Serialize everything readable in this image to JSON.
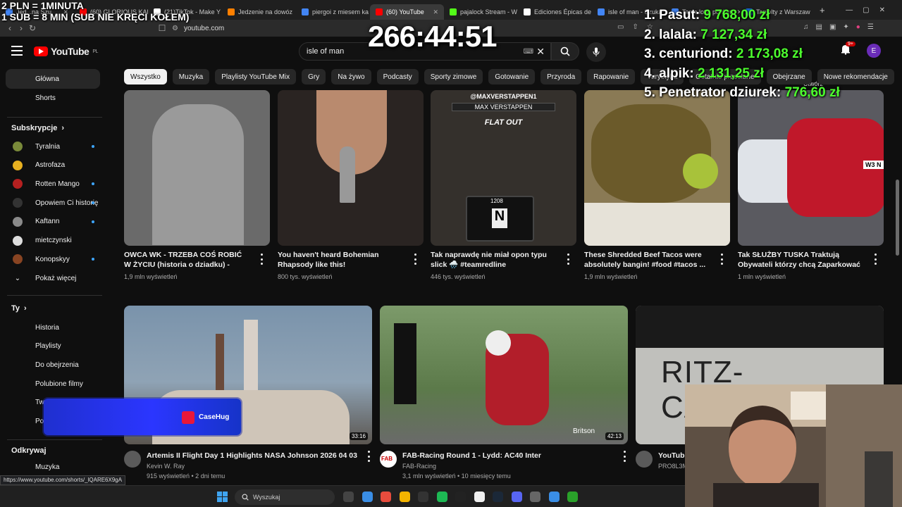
{
  "browser": {
    "tabs": [
      {
        "title": "Jed...na Szu",
        "fav": "#4285f4"
      },
      {
        "title": "(60) GLORIOUS KAR",
        "fav": "#ff0000"
      },
      {
        "title": "(21)TikTok - Make Y",
        "fav": "#ffffff"
      },
      {
        "title": "Jedzenie na dowóz",
        "fav": "#ff8000"
      },
      {
        "title": "piergoi z miesem ka",
        "fav": "#4285f4"
      },
      {
        "title": "(60) YouTube",
        "fav": "#ff0000"
      },
      {
        "title": "pajalock Stream - W",
        "fav": "#53fc18"
      },
      {
        "title": "Ediciones Épicas de",
        "fav": "#ffffff"
      },
      {
        "title": "isle of man - Szuka",
        "fav": "#4285f4"
      },
      {
        "title": "Tanie loty: porówn",
        "fav": "#4285f4"
      },
      {
        "title": "Taniolty z Warszaw",
        "fav": "#1a73e8"
      }
    ],
    "url": "youtube.com"
  },
  "yt": {
    "logo_text": "YouTube",
    "logo_region": "PL",
    "search_value": "isle of man",
    "notif_count": "9+",
    "profile_initial": "E",
    "user_label": "Utwórz"
  },
  "chips": [
    "Wszystko",
    "Muzyka",
    "Playlisty YouTube Mix",
    "Gry",
    "Na żywo",
    "Podcasty",
    "Sporty zimowe",
    "Gotowanie",
    "Przyroda",
    "Rapowanie",
    "Turystyka",
    "Ostatnio przesłane",
    "Obejrzane",
    "Nowe rekomendacje"
  ],
  "sidebar": {
    "main": [
      {
        "label": "Główna",
        "icon": "home-icon"
      },
      {
        "label": "Shorts",
        "icon": "shorts-icon"
      }
    ],
    "subs_heading": "Subskrypcje",
    "subs": [
      {
        "label": "Tyralnia",
        "color": "#7a8a3a",
        "dot": true
      },
      {
        "label": "Astrofaza",
        "color": "#e8b020",
        "dot": false
      },
      {
        "label": "Rotten Mango",
        "color": "#b52020",
        "dot": true
      },
      {
        "label": "Opowiem Ci historię",
        "color": "#333333",
        "dot": true
      },
      {
        "label": "Kaftann",
        "color": "#8a8a8a",
        "dot": true
      },
      {
        "label": "mietczynski",
        "color": "#dddddd",
        "dot": false
      },
      {
        "label": "Konopskyy",
        "color": "#884422",
        "dot": true
      }
    ],
    "show_more": "Pokaż więcej",
    "you_heading": "Ty",
    "you": [
      {
        "label": "Historia",
        "icon": "history-icon"
      },
      {
        "label": "Playlisty",
        "icon": "playlist-icon"
      },
      {
        "label": "Do obejrzenia",
        "icon": "clock-icon"
      },
      {
        "label": "Polubione filmy",
        "icon": "thumb-up-icon"
      },
      {
        "label": "Twoje filmy",
        "icon": "video-icon"
      },
      {
        "label": "Pobrane",
        "icon": "download-icon"
      }
    ],
    "explore_heading": "Odkrywaj",
    "explore": [
      {
        "label": "Muzyka",
        "icon": "music-icon"
      }
    ]
  },
  "row1": [
    {
      "title": "OWCA WK - TRZEBA COŚ ROBIĆ W ŻYCIU (historia o dziadku) - MOWA ...",
      "views": "1,9 mln wyświetleń",
      "bg": "#6a6a6a"
    },
    {
      "title": "You haven't heard Bohemian Rhapsody like this!",
      "views": "800 tys. wyświetleń",
      "bg": "#2a2422"
    },
    {
      "title": "Tak naprawdę nie miał opon typu slick 🌧️ #teamredline #maxverstappen ...",
      "views": "446 tys. wyświetleń",
      "bg": "#34302c",
      "overlay_tag": "@MAXVERSTAPPEN1",
      "overlay_name": "MAX VERSTAPPEN",
      "overlay_flat": "FLAT OUT",
      "overlay_gear": "N",
      "overlay_rpm": "1208"
    },
    {
      "title": "These Shredded Beef Tacos were absolutely bangin! #food #tacos ...",
      "views": "1,9 mln wyświetleń",
      "bg": "#8a7a55"
    },
    {
      "title": "Tak SŁUŻBY TUSKA Traktują Obywateli którzy chcą Zaparkować n...",
      "views": "1 mln wyświetleń",
      "bg": "#5a5a60",
      "plate": "W3 N"
    }
  ],
  "row2": [
    {
      "title": "Artemis II Flight Day 1 Highlights NASA Johnson 2026 04 03",
      "channel": "Kevin W. Ray",
      "meta": "915 wyświetleń • 2 dni temu",
      "duration": "33:16"
    },
    {
      "title": "FAB-Racing Round 1 - Lydd: AC40 Inter",
      "channel": "FAB-Racing",
      "meta": "3,1 mln wyświetleń • 10 miesięcy temu",
      "duration": "42:13",
      "brand": "Britson",
      "avatar_text": "FAB"
    },
    {
      "title": "YouTube Mix – ...",
      "channel": "PRO8L3M, DJ Ste...",
      "meta": "",
      "thumb_text": "RITZ-CARLTON"
    }
  ],
  "overlay": {
    "line1": "2 PLN = 1MINUTA",
    "line2": "1 SUB = 8 MIN (SUB NIE KRĘCI KOŁEM)",
    "timer": "266:44:51",
    "leaderboard": [
      {
        "name": "1. Pasut:",
        "amount": "9 768,00 zł"
      },
      {
        "name": "2. lalala:",
        "amount": "7 127,34 zł"
      },
      {
        "name": "3. centuriond:",
        "amount": "2 173,08 zł"
      },
      {
        "name": "4. alpik:",
        "amount": "2 131,25 zł"
      },
      {
        "name": "5. Penetrator dziurek:",
        "amount": "776,60 zł"
      }
    ],
    "casehug": "CaseHug"
  },
  "status_url": "https://www.youtube.com/shorts/_lQARE6X9gA",
  "taskbar": {
    "search_placeholder": "Wyszukaj"
  }
}
